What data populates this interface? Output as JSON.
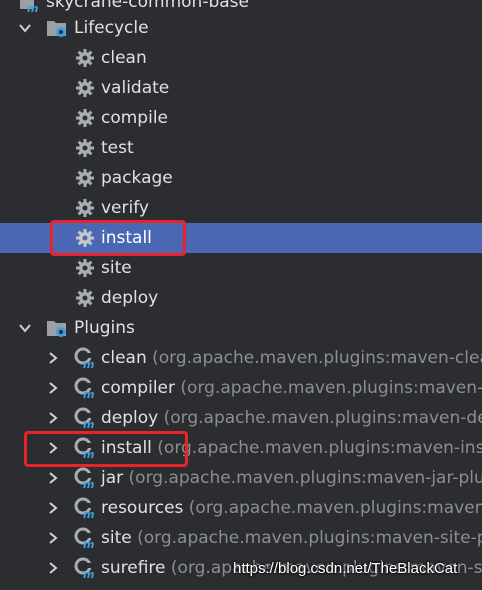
{
  "root": {
    "label": "skycrane-common-base"
  },
  "lifecycle": {
    "label": "Lifecycle",
    "items": [
      "clean",
      "validate",
      "compile",
      "test",
      "package",
      "verify",
      "install",
      "site",
      "deploy"
    ],
    "selected_item": "install"
  },
  "plugins": {
    "label": "Plugins",
    "items": [
      {
        "name": "clean",
        "detail": "(org.apache.maven.plugins:maven-clean"
      },
      {
        "name": "compiler",
        "detail": "(org.apache.maven.plugins:maven-comp"
      },
      {
        "name": "deploy",
        "detail": "(org.apache.maven.plugins:maven-deplo"
      },
      {
        "name": "install",
        "detail": "(org.apache.maven.plugins:maven-insta"
      },
      {
        "name": "jar",
        "detail": "(org.apache.maven.plugins:maven-jar-plug"
      },
      {
        "name": "resources",
        "detail": "(org.apache.maven.plugins:maven-reso"
      },
      {
        "name": "site",
        "detail": "(org.apache.maven.plugins:maven-site-plu"
      },
      {
        "name": "surefire",
        "detail": "(org.apache.maven.plugins:maven-sure"
      }
    ]
  },
  "watermark": "https://blog.csdn.net/TheBlackCat",
  "colors": {
    "background": "#2b2d30",
    "selection": "#4a67b3",
    "highlight_box": "#e8232a",
    "maven_icon": "#3d9ee0"
  },
  "icons": {
    "expand": "chevron-down-icon",
    "collapsed": "chevron-right-icon",
    "folder": "folder-gear-icon",
    "goal": "gear-icon",
    "plugin": "maven-plugin-icon"
  }
}
